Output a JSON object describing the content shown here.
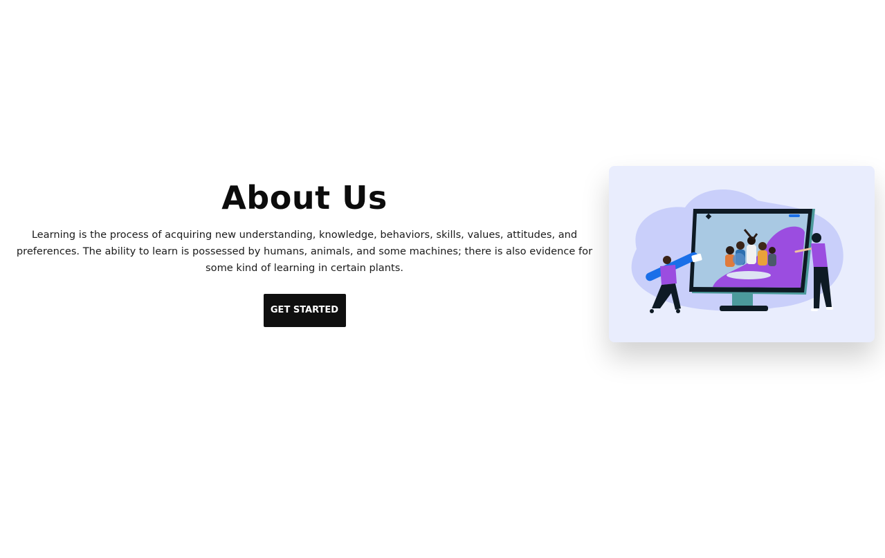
{
  "about": {
    "title": "About Us",
    "description": "Learning is the process of acquiring new understanding, knowledge, behaviors, skills, values, attitudes, and preferences. The ability to learn is possessed by humans, animals, and some machines; there is also evidence for some kind of learning in certain plants.",
    "cta_label": "GET STARTED"
  },
  "illustration": {
    "icon": "online-learning-illustration",
    "colors": {
      "card_bg": "#e9edfd",
      "blob": "#c9cffa",
      "accent_purple": "#9b4de0",
      "screen_bg": "#a9c9e3",
      "monitor_stand": "#4c9a9c",
      "dark": "#0e1a24",
      "accent_blue": "#1a6fe8"
    }
  }
}
